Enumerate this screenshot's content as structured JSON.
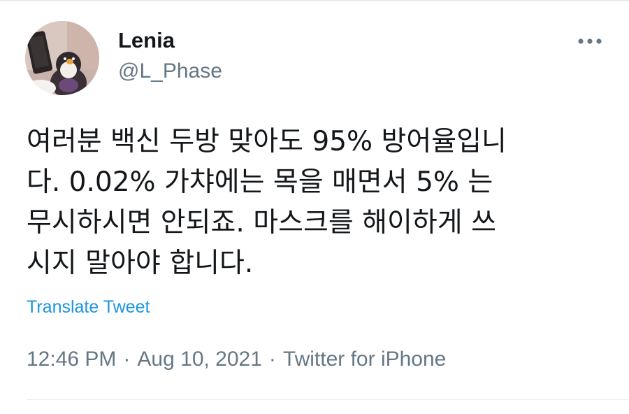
{
  "user": {
    "display_name": "Lenia",
    "handle": "@L_Phase"
  },
  "icons": {
    "avatar": "profile-photo",
    "more": "more-horizontal-icon"
  },
  "tweet": {
    "lines": [
      "여러분 백신 두방 맞아도 95% 방어율입니",
      "다. 0.02% 가챠에는 목을 매면서 5% 는",
      "무시하시면 안되죠. 마스크를 해이하게 쓰",
      "시지 말아야 합니다."
    ],
    "translate_label": "Translate Tweet",
    "time": "12:46 PM",
    "date": "Aug 10, 2021",
    "source": "Twitter for iPhone",
    "separator": "·"
  },
  "colors": {
    "text": "#14171a",
    "secondary": "#657786",
    "link": "#1b95e0",
    "divider": "#e6ecf0"
  }
}
